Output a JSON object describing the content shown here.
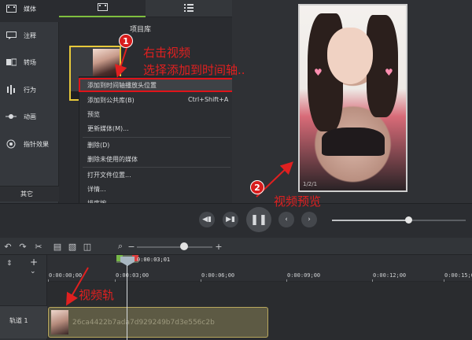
{
  "sidebar": {
    "items": [
      {
        "label": "媒体",
        "icon": "film-icon"
      },
      {
        "label": "注释",
        "icon": "annotation-icon"
      },
      {
        "label": "转场",
        "icon": "transition-icon"
      },
      {
        "label": "行为",
        "icon": "behavior-icon"
      },
      {
        "label": "动画",
        "icon": "animation-icon"
      },
      {
        "label": "指针效果",
        "icon": "cursor-effect-icon"
      }
    ],
    "other_label": "其它",
    "add_label": "+"
  },
  "bin": {
    "title": "项目库",
    "tabs": [
      "film-icon",
      "list-icon"
    ]
  },
  "context_menu": {
    "items": [
      {
        "label": "添加到时间轴播放头位置",
        "shortcut": ""
      },
      {
        "label": "添加到公共库(B)",
        "shortcut": "Ctrl+Shift+A"
      },
      {
        "label": "预览",
        "shortcut": ""
      },
      {
        "label": "更新媒体(M)...",
        "shortcut": ""
      },
      {
        "label": "删除(D)",
        "shortcut": ""
      },
      {
        "label": "删除未使用的媒体",
        "shortcut": ""
      },
      {
        "label": "打开文件位置...",
        "shortcut": ""
      },
      {
        "label": "详情...",
        "shortcut": ""
      },
      {
        "label": "排序按",
        "shortcut": ""
      }
    ]
  },
  "preview": {
    "watermark": "1/2/1"
  },
  "player": {
    "buttons": [
      "rewind-icon",
      "step-icon",
      "pause-icon",
      "prev-icon",
      "next-icon"
    ],
    "progress": 0.57
  },
  "timeline": {
    "toolbar_icons": [
      "undo-icon",
      "redo-icon",
      "cut-icon",
      "copy-icon",
      "paste-icon",
      "split-icon",
      "zoom-icon",
      "zoom-out-icon",
      "zoom-in-icon"
    ],
    "zoom_level": 0.63,
    "playhead_time": "0:00:03;01",
    "ticks": [
      "0:00:00;00",
      "0:00:03;00",
      "0:00:06;00",
      "0:00:09;00",
      "0:00:12;00",
      "0:00:15;00"
    ],
    "track_label": "轨道 1",
    "clip_name": "26ca4422b7ada7d929249b7d3e556c2b"
  },
  "annotations": {
    "step1_badge": "1",
    "step2_badge": "2",
    "step1_line1": "右击视频",
    "step1_line2": "选择添加到时间轴..",
    "step2_text": "视频预览",
    "track_text": "视频轨",
    "color": "#e02020"
  }
}
